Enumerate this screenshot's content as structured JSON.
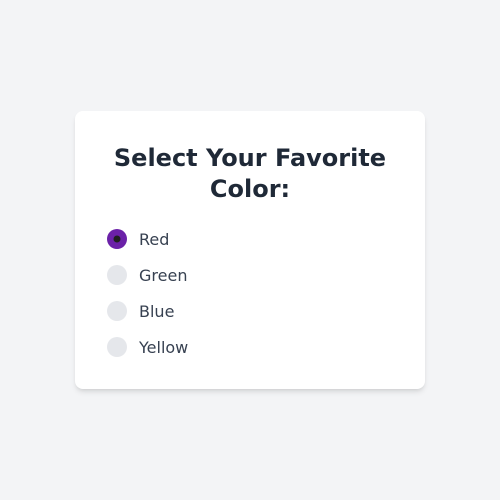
{
  "title": "Select Your Favorite Color:",
  "options": [
    {
      "label": "Red",
      "selected": true
    },
    {
      "label": "Green",
      "selected": false
    },
    {
      "label": "Blue",
      "selected": false
    },
    {
      "label": "Yellow",
      "selected": false
    }
  ]
}
